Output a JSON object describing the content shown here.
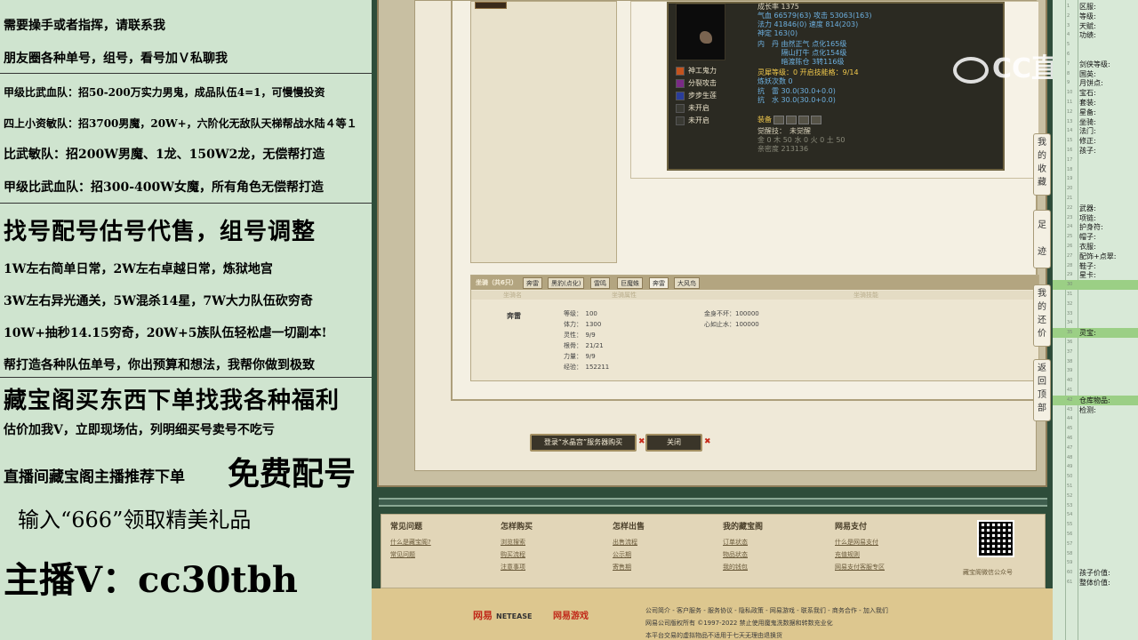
{
  "left_panel": {
    "lines": [
      "需要操手或者指挥，请联系我",
      "朋友圈各种单号，组号，看号加Ｖ私聊我",
      "甲级比武血队：招50-200万实力男鬼，成品队伍4=1，可慢慢投资",
      "四上小资敏队：招3700男魔，20W+，六阶化无敌队天梯帮战水陆４等１",
      "比武敏队：招200W男魔、1龙、150W2龙，无偿帮打造",
      "甲级比武血队：招300-400W女魔，所有角色无偿帮打造",
      "找号配号估号代售，组号调整",
      "1W左右简单日常，2W左右卓越日常，炼狱地宫",
      "3W左右异光通关，5W混杀14星，7W大力队伍砍穷奇",
      "10W+抽秒14.15穷奇，20W+5族队伍轻松虐一切副本!",
      "帮打造各种队伍单号，你出预算和想法，我帮你做到极致",
      "藏宝阁买东西下单找我各种福利",
      "估价加我V，立即现场估，列明细买号卖号不吃亏",
      "直播间藏宝阁主播推荐下单",
      "免费配号",
      "输入“666”领取精美礼品",
      "主播V：cc30tbh"
    ]
  },
  "watermark": {
    "text": "CC直播"
  },
  "character": {
    "stats": [
      "成长率 1375",
      "气血 66579(63) 攻击 53063(163)",
      "法力 41846(0) 速度 814(203)",
      "神定 163(0)",
      "内　丹 由然正气 点化165级",
      "　　　 隔山打牛 点化154级",
      "　　　 暗渡陈仓 3转116级",
      "灵犀等级：0  开启技能格：9/14",
      "炼妖次数 0",
      "抗　雷 30.0(30.0+0.0)",
      "抗　水 30.0(30.0+0.0)",
      "装备",
      "觉醒技：　未觉醒",
      "金 0 木 50 水 0 火 0 土 50",
      "亲密度 213136"
    ],
    "skills": [
      "神工鬼力",
      "分裂攻击",
      "步步生莲",
      "未开启",
      "未开启"
    ]
  },
  "mount": {
    "tabs": [
      "坐骑（共6只）",
      "奔雷",
      "黑豹(点化)",
      "雷鸣",
      "巨魔蛛",
      "奔雷",
      "大风鸟"
    ],
    "subheads": [
      "坐骑名",
      "坐骑属性",
      "坐骑技能"
    ],
    "name": "奔雷",
    "stats": [
      "等级：　100",
      "体力：　1300",
      "灵性：　9/9",
      "根骨：　21/21",
      "力量：　9/9",
      "经验：　152211"
    ],
    "skills": [
      "金身不坏：100000",
      "心如止水：100000"
    ]
  },
  "buttons": {
    "login_buy": "登录“水晶宫”服务器购买",
    "close": "关闭",
    "x_mark": "✖"
  },
  "side_tabs": [
    "我的收藏",
    "足迹",
    "我的还价",
    "返回顶部"
  ],
  "footer": {
    "columns": [
      {
        "title": "常见问题",
        "links": [
          "什么是藏宝阁?",
          "常见问题"
        ]
      },
      {
        "title": "怎样购买",
        "links": [
          "浏览搜索",
          "购买流程",
          "注意事项"
        ]
      },
      {
        "title": "怎样出售",
        "links": [
          "出售流程",
          "公示期",
          "寄售期"
        ]
      },
      {
        "title": "我的藏宝阁",
        "links": [
          "订单状态",
          "物品状态",
          "我的钱包"
        ]
      },
      {
        "title": "网易支付",
        "links": [
          "什么是网易支付",
          "充值规则",
          "网易支付客服专区"
        ]
      }
    ],
    "qr_caption": "藏宝阁微信公众号"
  },
  "bottom": {
    "netease": "网易",
    "netease_en": "NETEASE",
    "netease_games": "网易游戏",
    "links": "公司简介 - 客户服务 - 服务协议 - 隐私政策 - 网易游戏 - 联系我们 - 商务合作 - 加入我们",
    "copyright": "网易公司版权所有 ©1997-2022  禁止使用魔鬼洗数据和转数充业化",
    "notice": "本平台交易的虚拟物品不适用于七天无理由退换货"
  },
  "right_panel": {
    "rows": [
      "区服:",
      "等级:",
      "天赋:",
      "功绩:",
      "",
      "",
      "剑侠等级:",
      "国英:",
      "月饼点:",
      "宝石:",
      "套装:",
      "星备:",
      "坐骑:",
      "法门:",
      "修正:",
      "孩子:",
      "",
      "",
      "",
      "",
      "",
      "武器:",
      "项链:",
      "护身符:",
      "帽子:",
      "衣服:",
      "配饰+点翠:",
      "鞋子:",
      "星卡:",
      "",
      "",
      "",
      "",
      "",
      "灵宝:",
      "",
      "",
      "",
      "",
      "",
      "",
      "仓库物品:",
      "检测:",
      "",
      "",
      "",
      "",
      "",
      "",
      "",
      "",
      "",
      "",
      "",
      "",
      "",
      "",
      "",
      "",
      "孩子价值:",
      "整体价值:"
    ],
    "highlight_rows": [
      29,
      34,
      41
    ]
  }
}
